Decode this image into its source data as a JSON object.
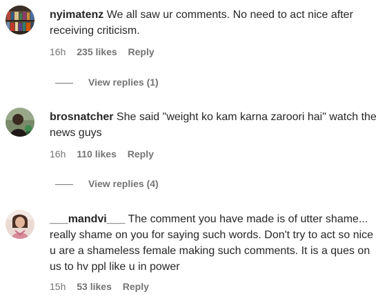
{
  "comments": [
    {
      "username": "nyimatenz",
      "text": "We all saw ur comments. No need to act nice after receiving criticism.",
      "time": "16h",
      "likes": "235 likes",
      "reply": "Reply",
      "view_replies": "View replies (1)"
    },
    {
      "username": "brosnatcher",
      "text": "She said \"weight ko kam karna zaroori hai\" watch the news guys",
      "time": "16h",
      "likes": "110 likes",
      "reply": "Reply",
      "view_replies": "View replies (4)"
    },
    {
      "username": "___mandvi___",
      "text": "The comment you have made is of utter shame... really shame on you for saying such words. Don't try to act so nice u are a shameless female making such comments. It is a ques on us to hv ppl like u in power",
      "time": "15h",
      "likes": "53 likes",
      "reply": "Reply"
    }
  ]
}
